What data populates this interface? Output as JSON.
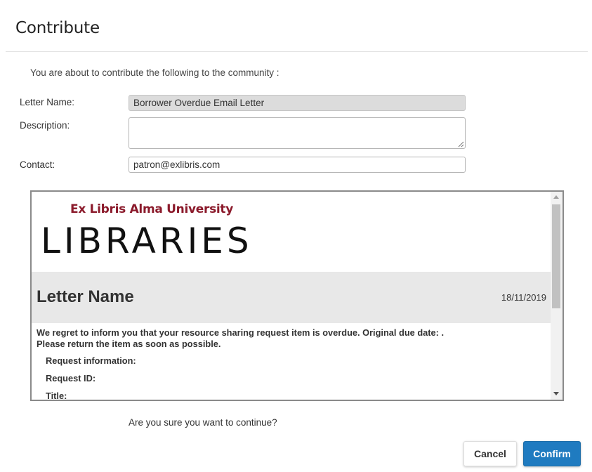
{
  "dialog": {
    "title": "Contribute",
    "intro": "You are about to contribute the following to the community :",
    "question": "Are you sure you want to continue?"
  },
  "form": {
    "letter_name_label": "Letter Name:",
    "letter_name_value": "Borrower Overdue Email Letter",
    "description_label": "Description:",
    "description_value": "",
    "contact_label": "Contact:",
    "contact_value": "patron@exlibris.com"
  },
  "preview": {
    "org_name": "Ex Libris Alma University",
    "logo_text": "LIBRARIES",
    "heading": "Letter Name",
    "date": "18/11/2019",
    "body_line_1": "We regret to inform you that your resource sharing request item is overdue. Original due date: .",
    "body_line_2": "Please return the item as soon as possible.",
    "info_request": "Request information:",
    "info_request_id": "Request ID:",
    "info_title": "Title:"
  },
  "buttons": {
    "cancel_label": "Cancel",
    "confirm_label": "Confirm"
  },
  "colors": {
    "brand_maroon": "#8b1a2b",
    "confirm_blue": "#1f7bc0",
    "header_gray": "#e8e8e8"
  },
  "icons": {
    "scroll_up": "triangle-up-icon",
    "scroll_down": "triangle-down-icon",
    "resize": "resize-grip-icon"
  }
}
